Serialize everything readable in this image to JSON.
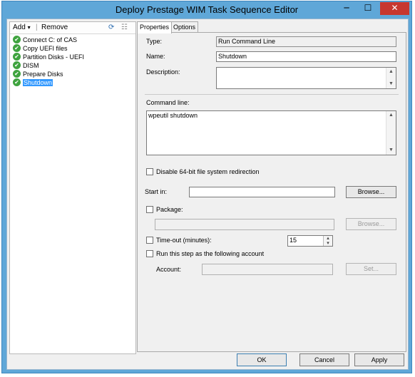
{
  "window": {
    "title": "Deploy Prestage WIM Task Sequence Editor",
    "minimize": "─",
    "maximize": "☐",
    "close": "✕"
  },
  "toolbar": {
    "add": "Add",
    "add_arrow": "▾",
    "remove": "Remove",
    "sep": "|",
    "icon_a": "⟳",
    "icon_b": "☷"
  },
  "steps": [
    {
      "label": "Connect C: of CAS",
      "selected": false
    },
    {
      "label": "Copy UEFI files",
      "selected": false
    },
    {
      "label": "Partition Disks - UEFI",
      "selected": false
    },
    {
      "label": "DISM",
      "selected": false
    },
    {
      "label": "Prepare Disks",
      "selected": false
    },
    {
      "label": "Shutdown",
      "selected": true
    }
  ],
  "check_glyph": "✔",
  "tabs": {
    "properties": "Properties",
    "options": "Options"
  },
  "form": {
    "type_label": "Type:",
    "type_value": "Run Command Line",
    "name_label": "Name:",
    "name_value": "Shutdown",
    "description_label": "Description:",
    "description_value": "",
    "command_label": "Command line:",
    "command_value": "wpeutil shutdown",
    "disable64_label": "Disable 64-bit file system redirection",
    "startin_label": "Start in:",
    "startin_value": "",
    "browse": "Browse...",
    "package_label": "Package:",
    "package_value": "",
    "browse_pkg": "Browse...",
    "timeout_label": "Time-out (minutes):",
    "timeout_value": "15",
    "runas_label": "Run this step as the following account",
    "account_label": "Account:",
    "account_value": "",
    "set": "Set..."
  },
  "scroll": {
    "up": "▲",
    "down": "▼"
  },
  "spin": {
    "up": "▴",
    "down": "▾"
  },
  "buttons": {
    "ok": "OK",
    "cancel": "Cancel",
    "apply": "Apply"
  }
}
